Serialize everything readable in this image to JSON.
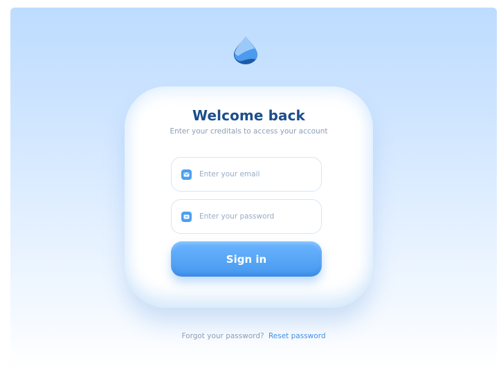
{
  "login": {
    "title": "Welcome back",
    "subtitle": "Enter your creditals to access your account",
    "email": {
      "placeholder": "Enter your email",
      "value": ""
    },
    "password": {
      "placeholder": "Enter your password",
      "value": ""
    },
    "sign_in_label": "Sign in"
  },
  "footer": {
    "prompt": "Forgot your password?",
    "link": "Reset password"
  },
  "icons": {
    "logo": "water-drop-icon",
    "email": "mail-icon",
    "password": "lock-icon"
  },
  "colors": {
    "accent": "#4d9ff0",
    "title": "#1b4e8d",
    "link": "#3f8fe2",
    "muted_text": "#8a9db6",
    "background_top": "#bddcff",
    "background_bottom": "#ffffff"
  }
}
